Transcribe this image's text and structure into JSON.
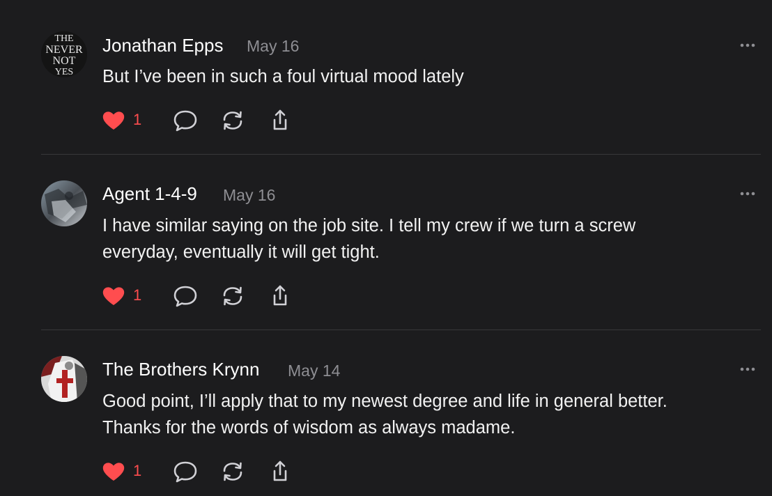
{
  "comments": [
    {
      "author": "Jonathan Epps",
      "date": "May 16",
      "avatar_text": [
        "THE",
        "NEVER",
        "NOT",
        "YES"
      ],
      "lines": [
        "But I’ve been in such a foul virtual mood lately"
      ],
      "likes": "1",
      "liked": true
    },
    {
      "author": "Agent 1-4-9",
      "date": "May 16",
      "lines": [
        "I have similar saying on the job site. I tell my crew if we turn a screw",
        "everyday, eventually it will get tight."
      ],
      "likes": "1",
      "liked": true
    },
    {
      "author": "The Brothers Krynn",
      "date": "May 14",
      "lines": [
        "Good point, I’ll apply that to my newest degree and life in general better.",
        "Thanks for the words of wisdom as always madame."
      ],
      "likes": "1",
      "liked": true
    }
  ],
  "icons": {
    "like": "heart-icon",
    "reply": "speech-bubble-icon",
    "restack": "restack-icon",
    "share": "share-icon",
    "more": "more-dots-icon"
  },
  "colors": {
    "background": "#1c1c1e",
    "accent_like": "#ff4d4f",
    "muted": "#8e8e93",
    "icon": "#d1d1d6",
    "divider": "#38383a"
  }
}
